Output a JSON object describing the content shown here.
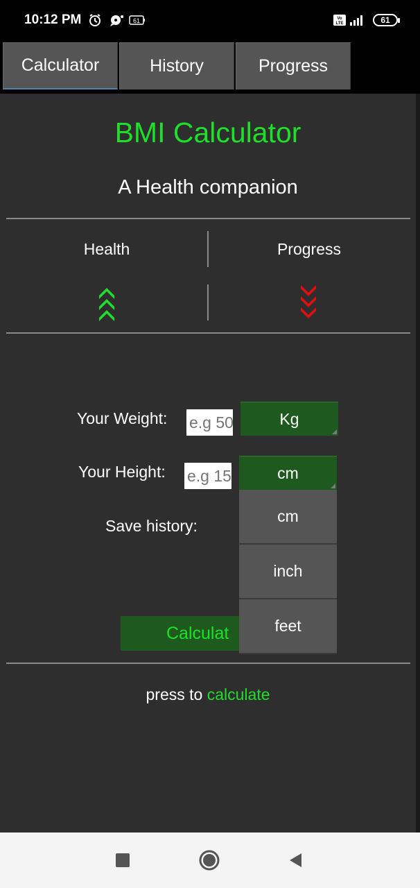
{
  "status_bar": {
    "time": "10:12 PM",
    "battery_small": "61",
    "battery": "61",
    "icons": [
      "alarm-icon",
      "chat-icon",
      "battery-small-icon",
      "volte-icon",
      "signal-icon",
      "battery-icon"
    ]
  },
  "tabs": [
    {
      "label": "Calculator",
      "active": true
    },
    {
      "label": "History",
      "active": false
    },
    {
      "label": "Progress",
      "active": false
    }
  ],
  "header": {
    "title": "BMI Calculator",
    "subtitle": "A Health companion"
  },
  "indicators": {
    "health_label": "Health",
    "health_direction": "up",
    "health_icon": "triple-chevron-up-icon",
    "progress_label": "Progress",
    "progress_direction": "down",
    "progress_icon": "triple-chevron-down-icon"
  },
  "form": {
    "weight_label": "Your Weight:",
    "weight_placeholder": "e.g 50",
    "weight_unit": "Kg",
    "height_label": "Your Height:",
    "height_placeholder": "e.g 15",
    "height_unit": "cm",
    "save_history_label": "Save history:"
  },
  "height_unit_options": [
    "cm",
    "inch",
    "feet"
  ],
  "calculate_button": "Calculat",
  "footer": {
    "press_text": "press to",
    "press_accent": "calculate"
  },
  "colors": {
    "accent_green": "#1ee02a",
    "button_green": "#1e5a1e",
    "down_red": "#e01010",
    "panel_bg": "#2e2e2e",
    "tab_bg": "#555555"
  },
  "nav": {
    "icons": [
      "recents-square-icon",
      "home-circle-icon",
      "back-triangle-icon"
    ]
  }
}
